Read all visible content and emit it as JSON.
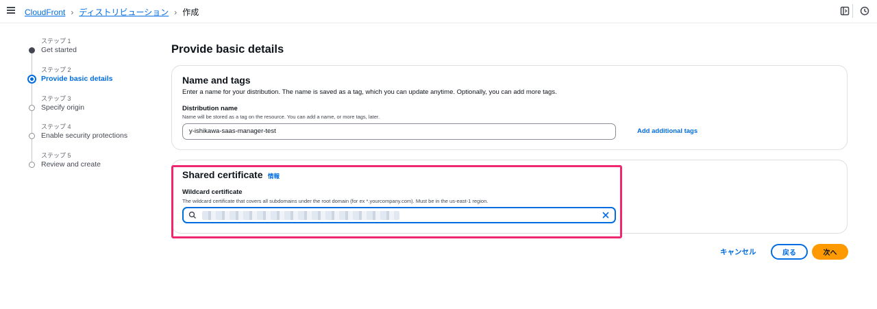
{
  "breadcrumb": {
    "items": [
      "CloudFront",
      "ディストリビューション"
    ],
    "current": "作成"
  },
  "steps": [
    {
      "num": "ステップ 1",
      "label": "Get started",
      "state": "done"
    },
    {
      "num": "ステップ 2",
      "label": "Provide basic details",
      "state": "active"
    },
    {
      "num": "ステップ 3",
      "label": "Specify origin",
      "state": "pending"
    },
    {
      "num": "ステップ 4",
      "label": "Enable security protections",
      "state": "pending"
    },
    {
      "num": "ステップ 5",
      "label": "Review and create",
      "state": "pending"
    }
  ],
  "page_title": "Provide basic details",
  "name_and_tags": {
    "title": "Name and tags",
    "description": "Enter a name for your distribution. The name is saved as a tag, which you can update anytime. Optionally, you can add more tags.",
    "field_label": "Distribution name",
    "field_hint": "Name will be stored as a tag on the resource. You can add a name, or more tags, later.",
    "field_value": "y-ishikawa-saas-manager-test",
    "add_tags_link": "Add additional tags"
  },
  "shared_certificate": {
    "title": "Shared certificate",
    "info_link": "情報",
    "field_label": "Wildcard certificate",
    "field_hint": "The wildcard certificate that covers all subdomains under the root domain (for ex *.yourcompany.com). Must be in the us-east-1 region."
  },
  "actions": {
    "cancel": "キャンセル",
    "back": "戻る",
    "next": "次へ"
  },
  "colors": {
    "accent": "#006ce0",
    "primary_button": "#ff9900",
    "highlight": "#f0276f"
  }
}
